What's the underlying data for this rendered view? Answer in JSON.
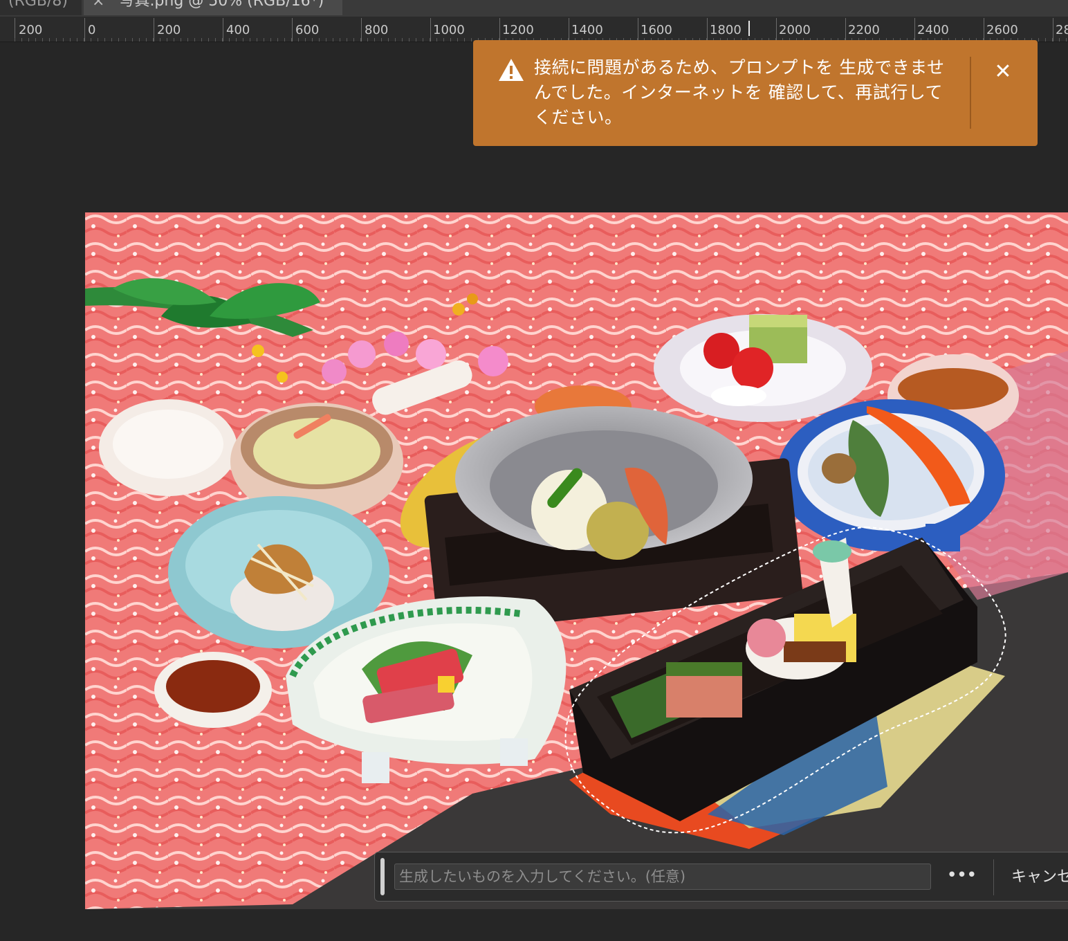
{
  "tabs": [
    {
      "label": "(RGB/8)",
      "active": false
    },
    {
      "label": "写真.png @ 50% (RGB/16*)",
      "active": true
    }
  ],
  "ruler": {
    "labels": [
      "200",
      "0",
      "200",
      "400",
      "600",
      "800",
      "1000",
      "1200",
      "1400",
      "1600",
      "1800",
      "2000",
      "2200",
      "2400",
      "2600",
      "28"
    ]
  },
  "toast": {
    "type": "warning",
    "icon": "warning-triangle-icon",
    "message": "接続に問題があるため、プロンプトを 生成できませんでした。インターネットを 確認して、再試行してください。",
    "color": "#c0752d"
  },
  "canvas": {
    "zoom": "50%",
    "image_description_icon": "food-photo-image"
  },
  "prompt_bar": {
    "placeholder": "生成したいものを入力してください。(任意)",
    "value": "",
    "more_label": "•••",
    "cancel_label": "キャンセ"
  }
}
